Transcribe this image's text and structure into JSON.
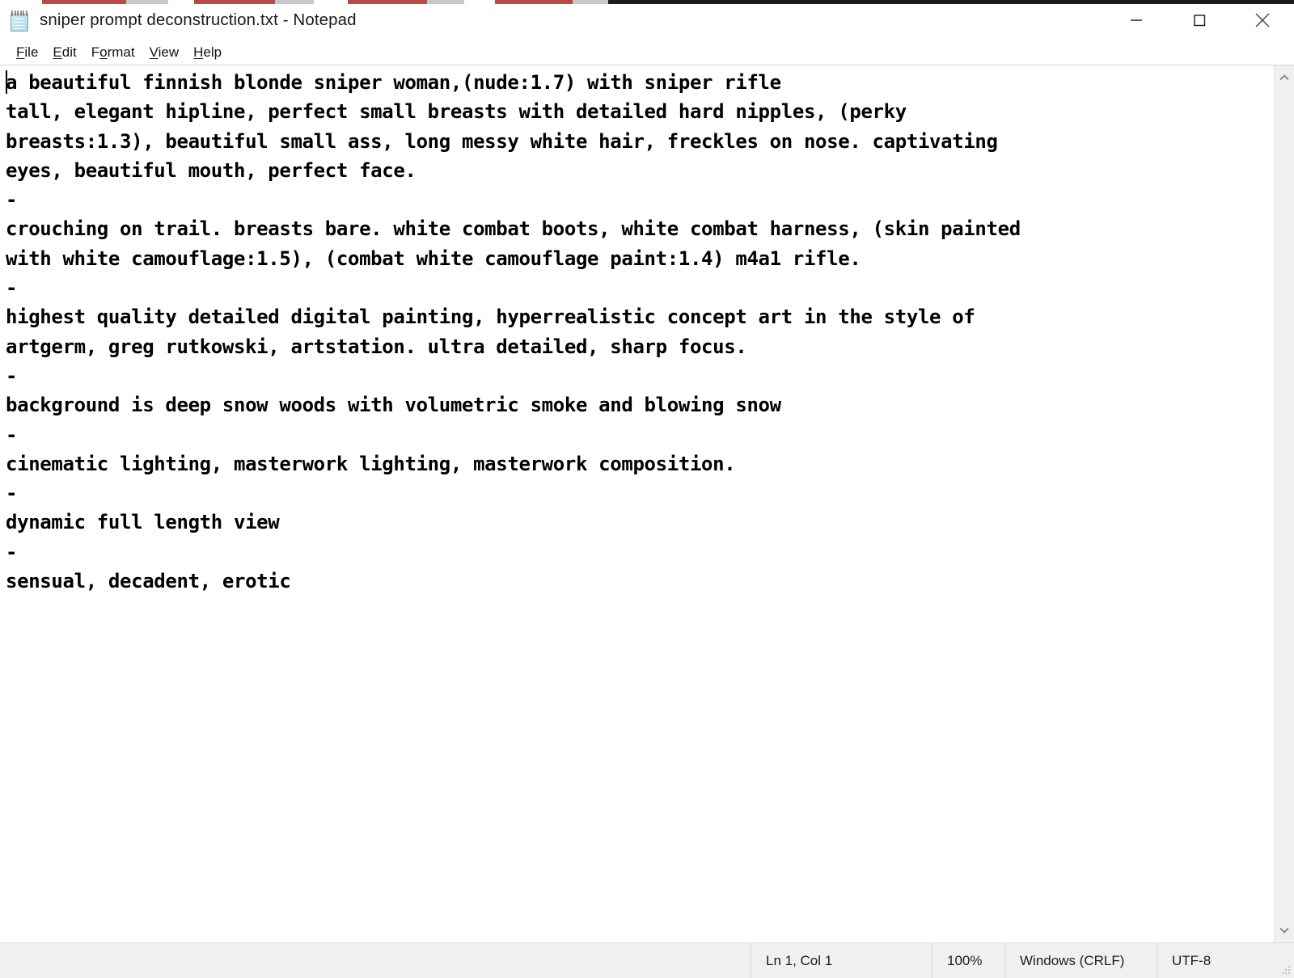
{
  "window": {
    "title": "sniper prompt deconstruction.txt - Notepad",
    "app_icon": "notepad-icon",
    "controls": [
      {
        "name": "minimize",
        "glyph": "minimize-icon"
      },
      {
        "name": "maximize",
        "glyph": "maximize-icon"
      },
      {
        "name": "close",
        "glyph": "close-icon"
      }
    ]
  },
  "menubar": {
    "items": [
      {
        "pre": "",
        "acc": "F",
        "post": "ile"
      },
      {
        "pre": "",
        "acc": "E",
        "post": "dit"
      },
      {
        "pre": "F",
        "acc": "o",
        "post": "rmat"
      },
      {
        "pre": "",
        "acc": "V",
        "post": "iew"
      },
      {
        "pre": "",
        "acc": "H",
        "post": "elp"
      }
    ]
  },
  "document": {
    "lines": [
      "a beautiful finnish blonde sniper woman,(nude:1.7) with sniper rifle",
      "tall, elegant hipline, perfect small breasts with detailed hard nipples, (perky",
      "breasts:1.3), beautiful small ass, long messy white hair, freckles on nose. captivating",
      "eyes, beautiful mouth, perfect face.",
      "-",
      "crouching on trail. breasts bare. white combat boots, white combat harness, (skin painted",
      "with white camouflage:1.5), (combat white camouflage paint:1.4) m4a1 rifle.",
      "-",
      "highest quality detailed digital painting, hyperrealistic concept art in the style of",
      "artgerm, greg rutkowski, artstation. ultra detailed, sharp focus.",
      "-",
      "background is deep snow woods with volumetric smoke and blowing snow",
      "-",
      "cinematic lighting, masterwork lighting, masterwork composition.",
      "-",
      "dynamic full length view",
      "-",
      "sensual, decadent, erotic"
    ]
  },
  "scrollbar": {
    "up_arrow": "chevron-up-icon",
    "down_arrow": "chevron-down-icon"
  },
  "statusbar": {
    "position": "Ln 1, Col 1",
    "zoom": "100%",
    "line_ending": "Windows (CRLF)",
    "encoding": "UTF-8"
  },
  "colors": {
    "window_bg": "#ffffff",
    "statusbar_bg": "#f0f0f0",
    "text": "#000000",
    "bleed_red": "#b02a23"
  }
}
